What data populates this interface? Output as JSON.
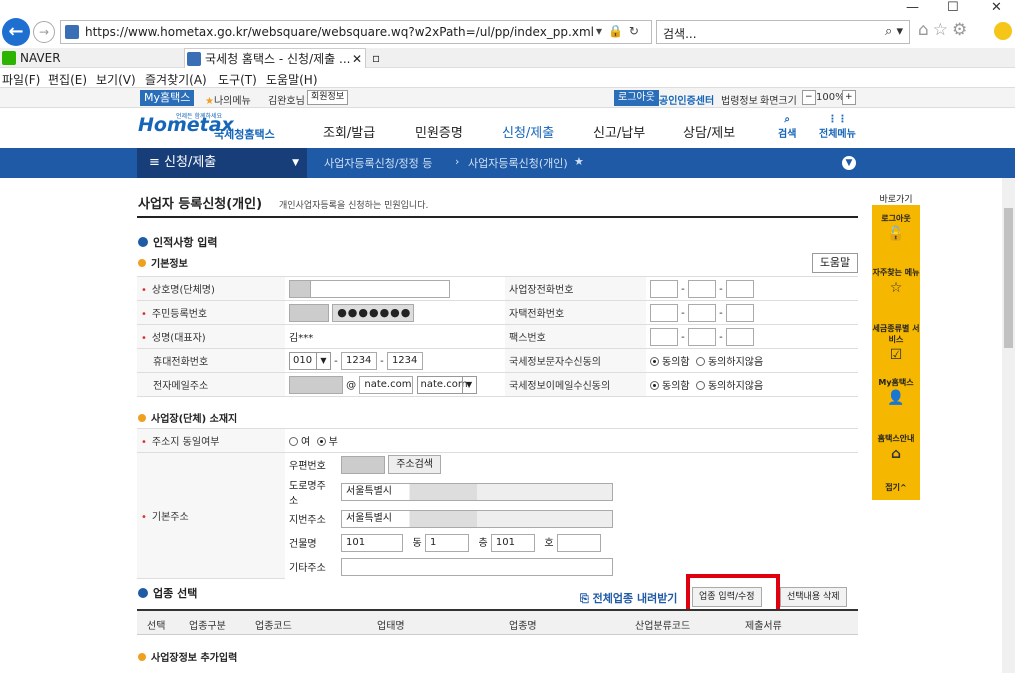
{
  "browser": {
    "url": "https://www.hometax.go.kr/websquare/websquare.wq?w2xPath=/ul/pp/index_pp.xml",
    "search_placeholder": "검색...",
    "tabs": [
      {
        "label": "NAVER"
      },
      {
        "label": "국세청 홈택스 - 신청/제출 ..."
      }
    ],
    "menu": [
      "파일(F)",
      "편집(E)",
      "보기(V)",
      "즐겨찾기(A)",
      "도구(T)",
      "도움말(H)"
    ]
  },
  "util": {
    "my_hometax": "My홈택스",
    "my_menu": "나의메뉴",
    "user": "김완호님",
    "member_info": "회원정보",
    "logout": "로그아웃",
    "cert_center": "공인인증센터",
    "law": "법령정보",
    "screen_size": "화면크기",
    "zoom": "100%"
  },
  "header": {
    "logo": "Hometax",
    "logo_tag": "언제든 함께하세요",
    "logo_sub": "국세청홈택스",
    "gnb": [
      "조회/발급",
      "민원증명",
      "신청/제출",
      "신고/납부",
      "상담/제보"
    ],
    "search": "검색",
    "all_menu": "전체메뉴"
  },
  "nav": {
    "current": "신청/제출",
    "crumb1": "사업자등록신청/정정 등",
    "crumb2": "사업자등록신청(개인)"
  },
  "page": {
    "title": "사업자 등록신청(개인)",
    "subtitle": "개인사업자등록을 신청하는 민원입니다.",
    "section_personal": "인적사항 입력",
    "sub_basic": "기본정보",
    "help": "도움말",
    "fields": {
      "name": "상호명(단체명)",
      "rrn": "주민등록번호",
      "rep": "성명(대표자)",
      "rep_value": "김***",
      "mobile": "휴대전화번호",
      "mobile1": "010",
      "mobile2": "1234",
      "mobile3": "1234",
      "email": "전자메일주소",
      "email_domain": "nate.com",
      "email_select": "nate.com",
      "biz_phone": "사업장전화번호",
      "home_phone": "자택전화번호",
      "fax": "팩스번호",
      "sms_consent": "국세정보문자수신동의",
      "email_consent": "국세정보이메일수신동의",
      "agree": "동의함",
      "disagree": "동의하지않음"
    },
    "sub_address": "사업장(단체) 소재지",
    "address": {
      "same_label": "주소지 동일여부",
      "yes": "여",
      "no": "부",
      "base_label": "기본주소",
      "postcode": "우편번호",
      "addr_search": "주소검색",
      "road": "도로명주소",
      "road_value": "서울특별시 ",
      "jibun": "지번주소",
      "jibun_value": "서울특별시 ",
      "building": "건물명",
      "building_value": "101",
      "dong_label": "동",
      "dong_value": "1",
      "floor_label": "층",
      "floor_value": "101",
      "ho_label": "호",
      "other": "기타주소"
    },
    "section_industry": "업종 선택",
    "industry_all": "전체업종 내려받기",
    "industry_edit": "업종 입력/수정",
    "industry_delete": "선택내용 삭제",
    "industry_cols": [
      "선택",
      "업종구분",
      "업종코드",
      "업태명",
      "업종명",
      "산업분류코드",
      "제출서류"
    ],
    "sub_extra": "사업장정보 추가입력"
  },
  "quick": {
    "title": "바로가기",
    "items": [
      "로그아웃",
      "자주찾는 메뉴",
      "세금종류별 서비스",
      "My홈택스",
      "홈택스안내",
      "접기"
    ]
  }
}
